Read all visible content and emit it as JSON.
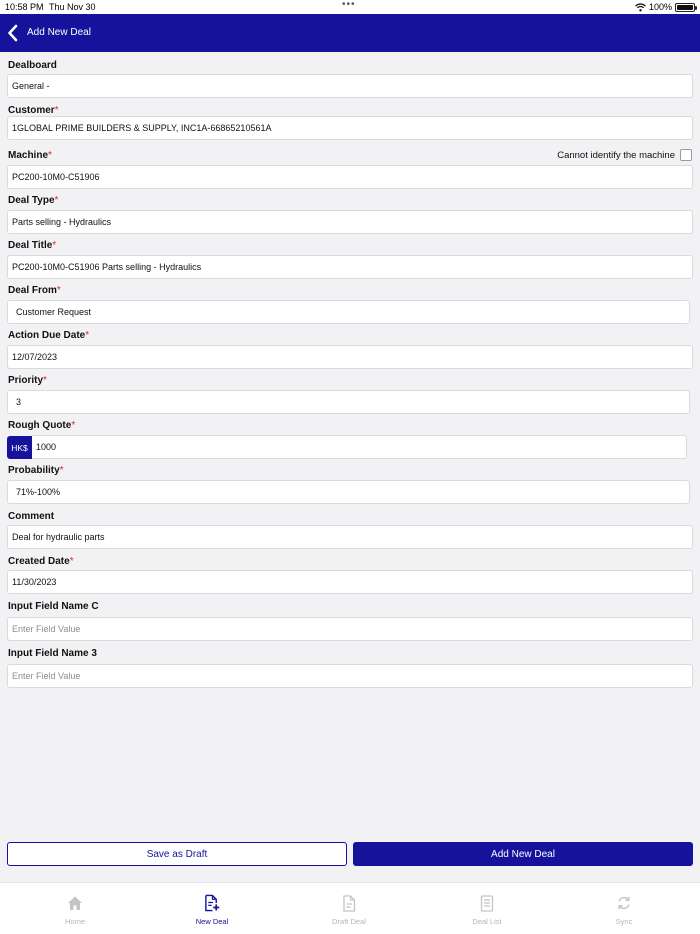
{
  "status_bar": {
    "time": "10:58 PM",
    "date": "Thu Nov 30",
    "dots": "•••",
    "battery": "100%"
  },
  "header": {
    "back_icon": "chevron-left-icon",
    "title": "Add New Deal"
  },
  "form": {
    "dealboard": {
      "label": "Dealboard",
      "value": "General -"
    },
    "customer": {
      "label": "Customer",
      "required": "*",
      "value": "1GLOBAL PRIME BUILDERS & SUPPLY, INC1A-66865210561A"
    },
    "machine": {
      "label": "Machine",
      "required": "*",
      "value": "PC200-10M0-C51906",
      "cannot_identify_label": "Cannot identify the machine"
    },
    "deal_type": {
      "label": "Deal Type",
      "required": "*",
      "value": "Parts selling - Hydraulics"
    },
    "deal_title": {
      "label": "Deal Title",
      "required": "*",
      "value": "PC200-10M0-C51906 Parts selling - Hydraulics"
    },
    "deal_from": {
      "label": "Deal From",
      "required": "*",
      "value": "Customer Request"
    },
    "action_due_date": {
      "label": "Action Due Date",
      "required": "*",
      "value": "12/07/2023"
    },
    "priority": {
      "label": "Priority",
      "required": "*",
      "value": "3"
    },
    "rough_quote": {
      "label": "Rough Quote",
      "required": "*",
      "currency": "HK$",
      "value": "1000"
    },
    "probability": {
      "label": "Probability",
      "required": "*",
      "value": "71%-100%"
    },
    "comment": {
      "label": "Comment",
      "value": "Deal for hydraulic parts"
    },
    "created_date": {
      "label": "Created Date",
      "required": "*",
      "value": "11/30/2023"
    },
    "input_c": {
      "label": "Input Field Name C",
      "placeholder": "Enter Field Value"
    },
    "input_3": {
      "label": "Input Field Name 3",
      "placeholder": "Enter Field Value"
    }
  },
  "actions": {
    "save_draft": "Save as Draft",
    "add_deal": "Add New Deal"
  },
  "tabs": [
    {
      "label": "Home",
      "icon": "home-icon"
    },
    {
      "label": "New Deal",
      "icon": "new-deal-icon"
    },
    {
      "label": "Draft Deal",
      "icon": "draft-deal-icon"
    },
    {
      "label": "Deal List",
      "icon": "deal-list-icon"
    },
    {
      "label": "Sync",
      "icon": "sync-icon"
    }
  ],
  "colors": {
    "primary": "#17129c",
    "required": "#e0221b",
    "inactive_tab": "#b5b5ba"
  }
}
